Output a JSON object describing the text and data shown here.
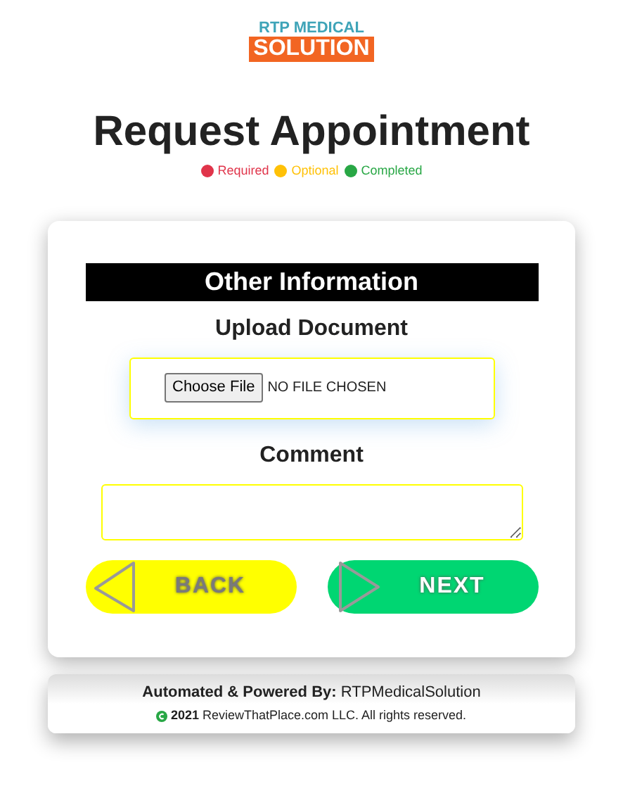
{
  "logo": {
    "line_1": "RTP MEDICAL",
    "line_2": "SOLUTION"
  },
  "title": "Request Appointment",
  "legend": [
    {
      "label": "Required",
      "color": "#e0344a"
    },
    {
      "label": "Optional",
      "color": "#ffc107"
    },
    {
      "label": "Completed",
      "color": "#28a745"
    }
  ],
  "section_title": "Other Information",
  "upload": {
    "label": "Upload Document",
    "button": "Choose File",
    "status": "NO FILE CHOSEN"
  },
  "comment": {
    "label": "Comment"
  },
  "buttons": [
    {
      "label": "BACK",
      "kind": "back"
    },
    {
      "label": "NEXT",
      "kind": "next"
    }
  ],
  "footer": {
    "powered": "**Automated & Powered By:** RTPMedicalSolution",
    "copyright": "**2021** ReviewThatPlace.com LLC. All rights reserved."
  }
}
